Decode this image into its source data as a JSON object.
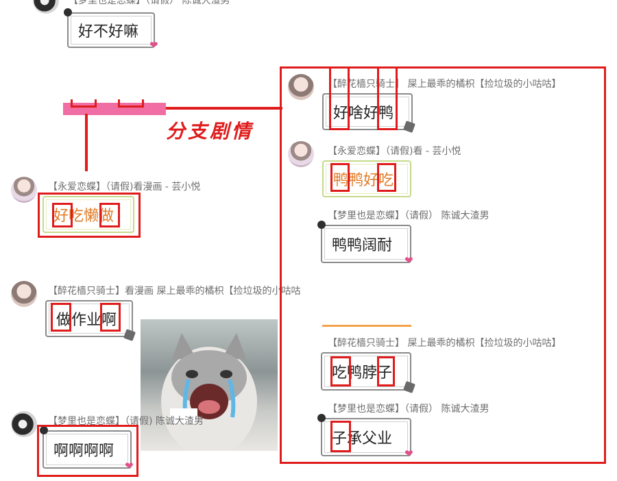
{
  "top": {
    "name": "【梦里也是恋蝶】（请假）        陈诚大渣男",
    "bubble": "好不好嘛"
  },
  "branch_label": "分支剧情",
  "left": {
    "msg1": {
      "name": "【永爱恋蝶】（请假)看漫画 - 芸小悦",
      "bubble": "好吃懒做"
    },
    "msg2": {
      "name": "【醉花樯只骑士】看漫画 屎上最乖的橘枳【捡垃圾的小咕咕",
      "bubble": "做作业啊"
    },
    "msg3": {
      "name": "【梦里也是恋蝶】（请假)         陈诚大渣男",
      "bubble": "啊啊啊啊"
    }
  },
  "right": {
    "msg1": {
      "name": "【醉花樯只骑士】          屎上最乖的橘枳【捡垃圾的小咕咕】",
      "bubble": "好啥好鸭"
    },
    "msg2": {
      "name": "【永爱恋蝶】（请假)看        - 芸小悦",
      "bubble": "鸭鸭好吃"
    },
    "msg3": {
      "name": "【梦里也是恋蝶】（请假）        陈诚大渣男",
      "bubble": "鸭鸭阔耐"
    },
    "msg4": {
      "name": "【醉花樯只骑士】          屎上最乖的橘枳【捡垃圾的小咕咕】",
      "bubble": "吃鸭脖子"
    },
    "msg5": {
      "name": "【梦里也是恋蝶】（请假）        陈诚大渣男",
      "bubble": "子承父业"
    }
  },
  "colors": {
    "highlight": "#e01b1b",
    "accent_text": "#e07a26"
  }
}
